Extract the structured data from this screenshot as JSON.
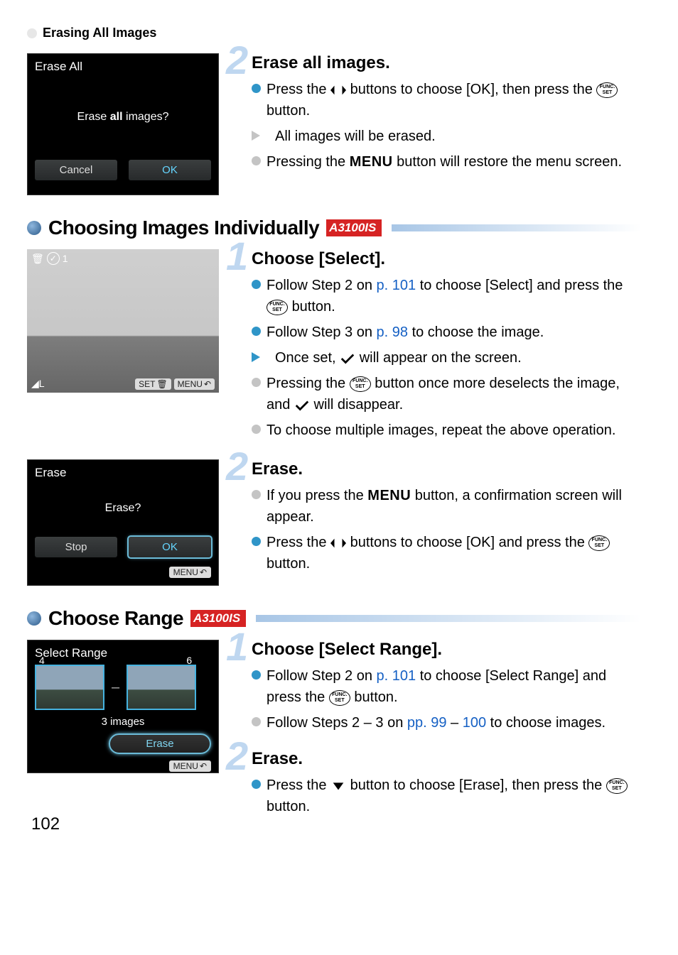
{
  "breadcrumb": "Erasing All Images",
  "screen_erase_all": {
    "title": "Erase All",
    "prompt": "Erase all images?",
    "cancel": "Cancel",
    "ok": "OK"
  },
  "s1_step2": {
    "num": "2",
    "title": "Erase all images.",
    "b1a": "Press the ",
    "b1b": " buttons to choose [OK], then press the ",
    "b1c": " button.",
    "b2": "All images will be erased.",
    "b3a": "Pressing the ",
    "b3_menu": "MENU",
    "b3b": " button will restore the menu screen."
  },
  "section2": {
    "title": "Choosing Images Individually",
    "badge": "A3100IS"
  },
  "screen_photo": {
    "count": "1",
    "bl": "L",
    "set": "SET",
    "menu": "MENU"
  },
  "s2_step1": {
    "num": "1",
    "title": "Choose [Select].",
    "b1a": "Follow Step 2 on ",
    "b1_link": "p. 101",
    "b1b": " to choose [Select] and press the ",
    "b1c": " button.",
    "b2a": "Follow Step 3 on ",
    "b2_link": "p. 98",
    "b2b": " to choose the image.",
    "b3a": "Once set, ",
    "b3b": " will appear on the screen.",
    "b4a": "Pressing the ",
    "b4b": " button once more deselects the image, and ",
    "b4c": " will disappear.",
    "b5": "To choose multiple images, repeat the above operation."
  },
  "screen_erase_confirm": {
    "title": "Erase",
    "prompt": "Erase?",
    "stop": "Stop",
    "ok": "OK",
    "menu": "MENU"
  },
  "s2_step2": {
    "num": "2",
    "title": "Erase.",
    "b1a": "If you press the ",
    "b1_menu": "MENU",
    "b1b": " button, a confirmation screen will appear.",
    "b2a": "Press the ",
    "b2b": " buttons to choose [OK] and press the ",
    "b2c": " button."
  },
  "section3": {
    "title": "Choose Range",
    "badge": "A3100IS"
  },
  "screen_range": {
    "title": "Select Range",
    "first_idx": "4",
    "last_idx": "6",
    "count": "3 images",
    "erase": "Erase",
    "menu": "MENU"
  },
  "s3_step1": {
    "num": "1",
    "title": "Choose [Select Range].",
    "b1a": "Follow Step 2 on ",
    "b1_link": "p. 101",
    "b1b": " to choose [Select Range] and press the ",
    "b1c": " button.",
    "b2a": "Follow Steps 2 – 3 on ",
    "b2_link": "pp. 99",
    "b2_mid": " – ",
    "b2_link2": "100",
    "b2b": " to choose images."
  },
  "s3_step2": {
    "num": "2",
    "title": "Erase.",
    "b1a": "Press the ",
    "b1b": " button to choose [Erase], then press the ",
    "b1c": " button."
  },
  "page_number": "102"
}
